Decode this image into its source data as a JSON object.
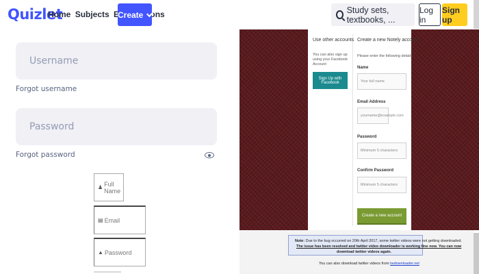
{
  "header": {
    "logo": "Quizlet",
    "nav": [
      "Home",
      "Subjects",
      "Explanations"
    ],
    "create_label": "Create",
    "search_placeholder": "Study sets, textbooks, ...",
    "login_label": "Log in",
    "signup_label": "Sign up",
    "brand_color": "#4255ff",
    "signup_color": "#ffcd1f"
  },
  "quizlet_form": {
    "username_placeholder": "Username",
    "forgot_username": "Forgot username",
    "password_placeholder": "Password",
    "forgot_password": "Forgot password"
  },
  "alt_form": {
    "full_name_placeholder": "Full Name",
    "email_placeholder": "Email",
    "password_placeholder": "Password"
  },
  "signup_modal": {
    "left_title": "Use other accounts",
    "left_desc": "You can also sign up using your Facebook Account",
    "facebook_button": "Sign Up with Facebook",
    "right_title": "Create a new Notely account",
    "right_desc": "Please enter the following details",
    "name_label": "Name",
    "name_placeholder": "Your full name",
    "email_label": "Email Address",
    "email_placeholder": "yourname@example.com",
    "password_label": "Password",
    "password_placeholder": "Minimum 5 characters",
    "confirm_label": "Confirm Password",
    "confirm_placeholder": "Minimum 5 characters",
    "create_button": "Create a new account",
    "background_color": "#5a1a1e",
    "button_color": "#7a9a32"
  },
  "notice": {
    "note_label": "Note:",
    "line1": "Due to the bug occurred on 20th April 2017, some twitter videos were not getting downloaded.",
    "line2": "The issue has been resolved and twitter video downloader is working fine now. You can now",
    "line3": "download twitter videos again.",
    "line4_prefix": "You can also download twitter videos from",
    "line4_link": "twdownloader.net"
  }
}
